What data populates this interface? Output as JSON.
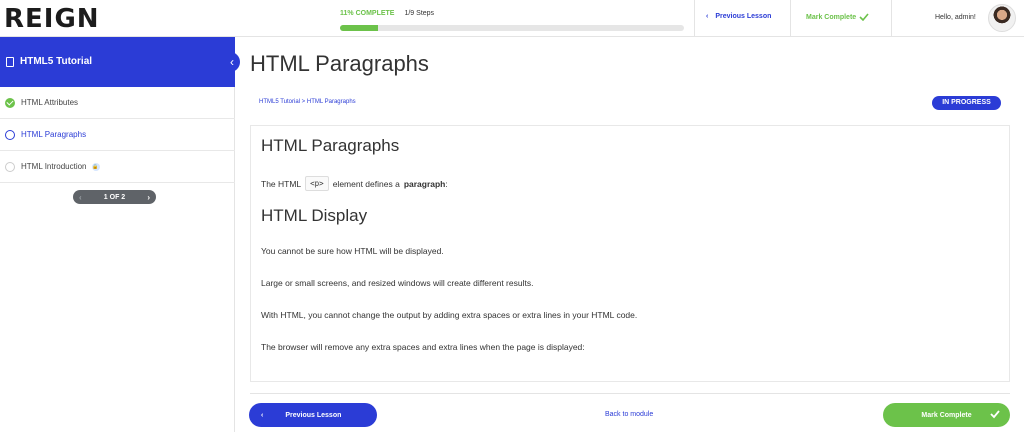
{
  "header": {
    "logo": "REIGN",
    "progress_percent_text": "11% COMPLETE",
    "steps_text": "1/9 Steps",
    "progress_fraction": 0.11,
    "prev_lesson": "Previous Lesson",
    "mark_complete": "Mark Complete",
    "greeting": "Hello, admin!"
  },
  "sidebar": {
    "course_title": "HTML5 Tutorial",
    "items": [
      {
        "label": "HTML Attributes",
        "state": "complete"
      },
      {
        "label": "HTML Paragraphs",
        "state": "current"
      },
      {
        "label": "HTML Introduction",
        "state": "locked"
      }
    ],
    "pager_text": "1 OF 2"
  },
  "main": {
    "title": "HTML Paragraphs",
    "breadcrumb": {
      "course": "HTML5 Tutorial",
      "separator": " > ",
      "lesson": "HTML Paragraphs"
    },
    "status": "IN PROGRESS",
    "content": {
      "heading1": "HTML Paragraphs",
      "p1_before": "The HTML",
      "p1_code": "<p>",
      "p1_middle": "element defines a",
      "p1_bold": "paragraph",
      "p1_after": ":",
      "heading2": "HTML Display",
      "paragraphs": [
        "You cannot be sure how HTML will be displayed.",
        "Large or small screens, and resized windows will create different results.",
        "With HTML, you cannot change the output by adding extra spaces or extra lines in your HTML code.",
        "The browser will remove any extra spaces and extra lines when the page is displayed:"
      ]
    }
  },
  "footer": {
    "prev_button": "Previous Lesson",
    "back_link": "Back to module",
    "complete_button": "Mark Complete"
  },
  "colors": {
    "brand_blue": "#2b3cd6",
    "success_green": "#6cc24a"
  },
  "icons": [
    "book-icon",
    "chevron-left-icon",
    "check-icon",
    "lock-icon"
  ]
}
